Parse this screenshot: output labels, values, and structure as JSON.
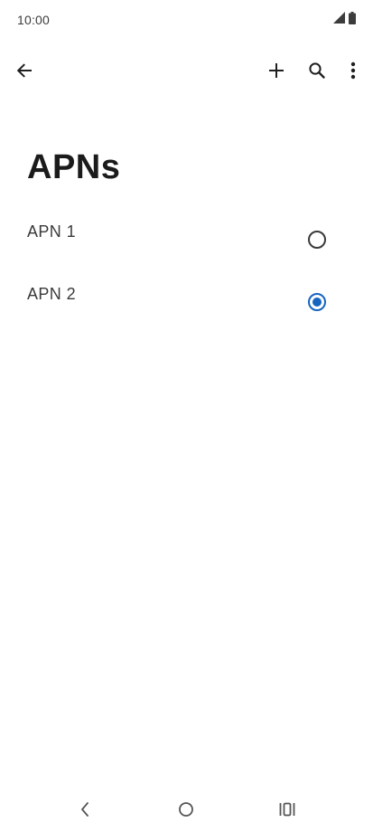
{
  "colors": {
    "accent": "#1565c0",
    "text": "#1f1f1f"
  },
  "status_bar": {
    "time": "10:00",
    "icons": [
      "signal-icon",
      "battery-icon"
    ]
  },
  "app_bar": {
    "icons": [
      "back-arrow-icon",
      "plus-icon",
      "search-icon",
      "more-vert-icon"
    ]
  },
  "page": {
    "title": "APNs"
  },
  "apns": [
    {
      "label": "APN 1",
      "selected": false
    },
    {
      "label": "APN 2",
      "selected": true
    }
  ],
  "nav_bar": {
    "icons": [
      "nav-back-icon",
      "nav-home-icon",
      "nav-recents-icon"
    ]
  }
}
